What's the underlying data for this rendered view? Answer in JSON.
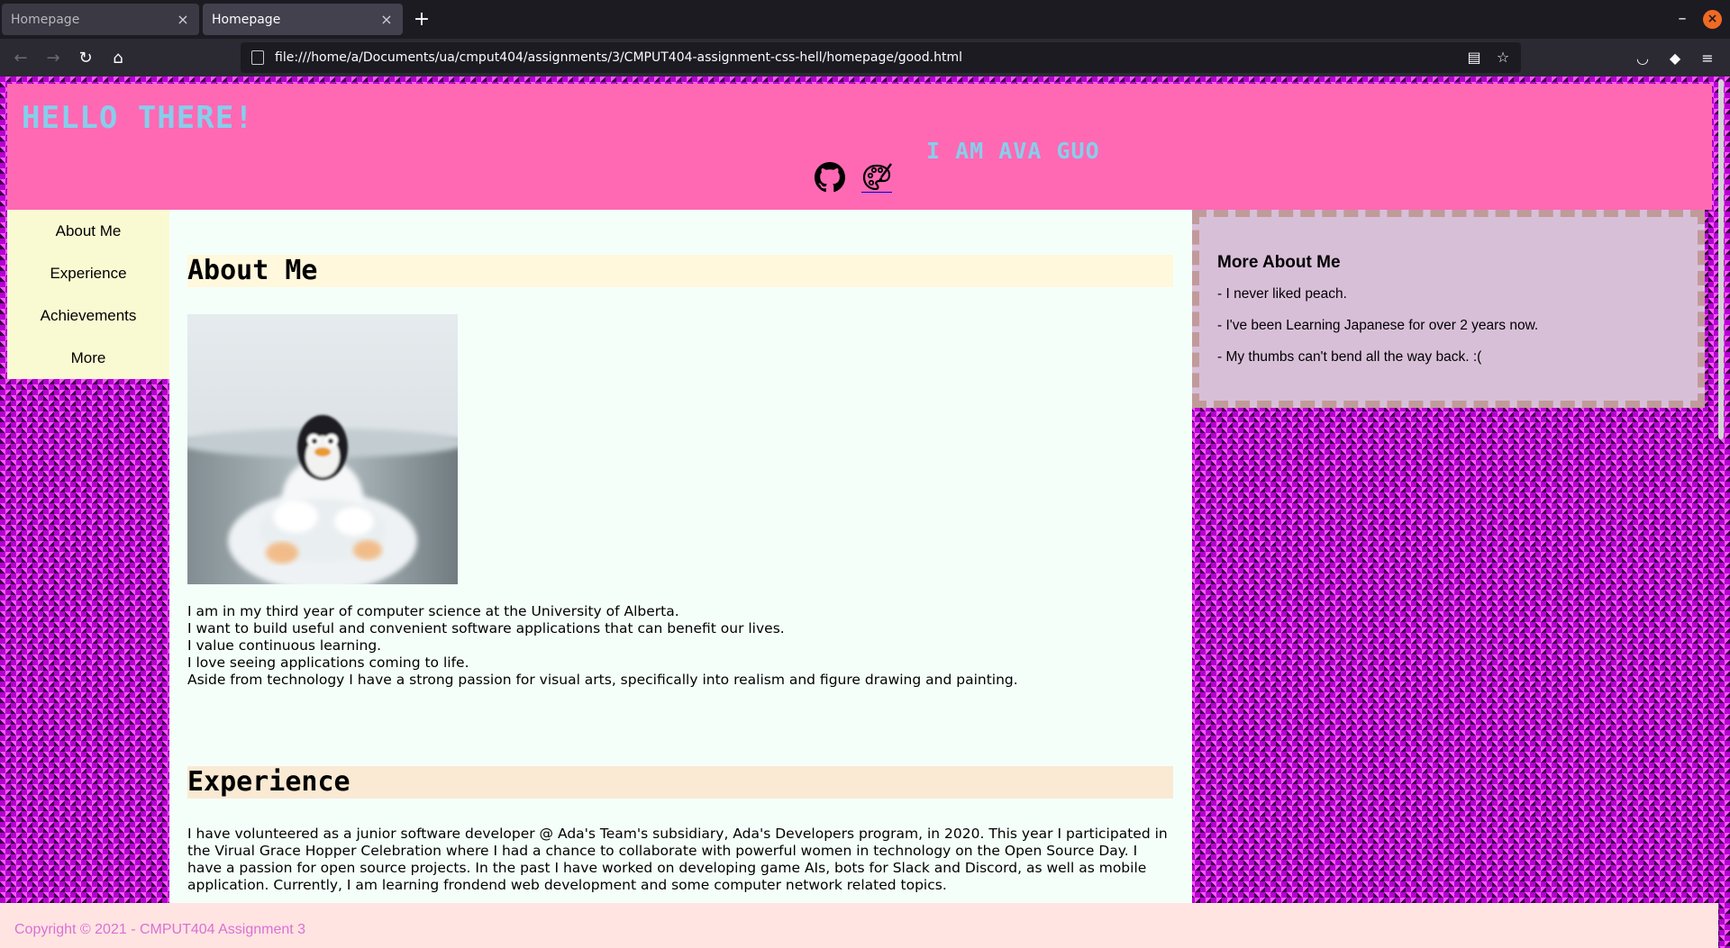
{
  "browser": {
    "tabs": [
      {
        "title": "Homepage",
        "active": false
      },
      {
        "title": "Homepage",
        "active": true
      }
    ],
    "url": "file:///home/a/Documents/ua/cmput404/assignments/3/CMPUT404-assignment-css-hell/homepage/good.html",
    "icons": {
      "close": "×",
      "newtab": "+",
      "back": "←",
      "forward": "→",
      "reload": "↻",
      "home": "⌂",
      "reader": "▤",
      "bookmark": "☆",
      "pocket": "◡",
      "extension": "◆",
      "menu": "≡",
      "minimize": "–"
    }
  },
  "site": {
    "greeting": "HELLO THERE!",
    "subtitle": "I AM AVA GUO",
    "nav": [
      "About Me",
      "Experience",
      "Achievements",
      "More"
    ],
    "about": {
      "title": "About Me",
      "lines": [
        "I am in my third year of computer science at the University of Alberta.",
        "I want to build useful and convenient software applications that can benefit our lives.",
        "I value continuous learning.",
        "I love seeing applications coming to life.",
        "Aside from technology I have a strong passion for visual arts, specifically into realism and figure drawing and painting."
      ]
    },
    "experience": {
      "title": "Experience",
      "text": "I have volunteered as a junior software developer @ Ada's Team's subsidiary, Ada's Developers program, in 2020. This year I participated in the Virual Grace Hopper Celebration where I had a chance to collaborate with powerful women in technology on the Open Source Day. I have a passion for open source projects. In the past I have worked on developing game AIs, bots for Slack and Discord, as well as mobile application. Currently, I am learning frondend web development and some computer network related topics."
    },
    "more_about": {
      "title": "More About Me",
      "items": [
        "- I never liked peach.",
        "- I've been Learning Japanese for over 2 years now.",
        "- My thumbs can't bend all the way back. :("
      ]
    },
    "footer": "Copyright © 2021 - CMPUT404 Assignment 3"
  }
}
